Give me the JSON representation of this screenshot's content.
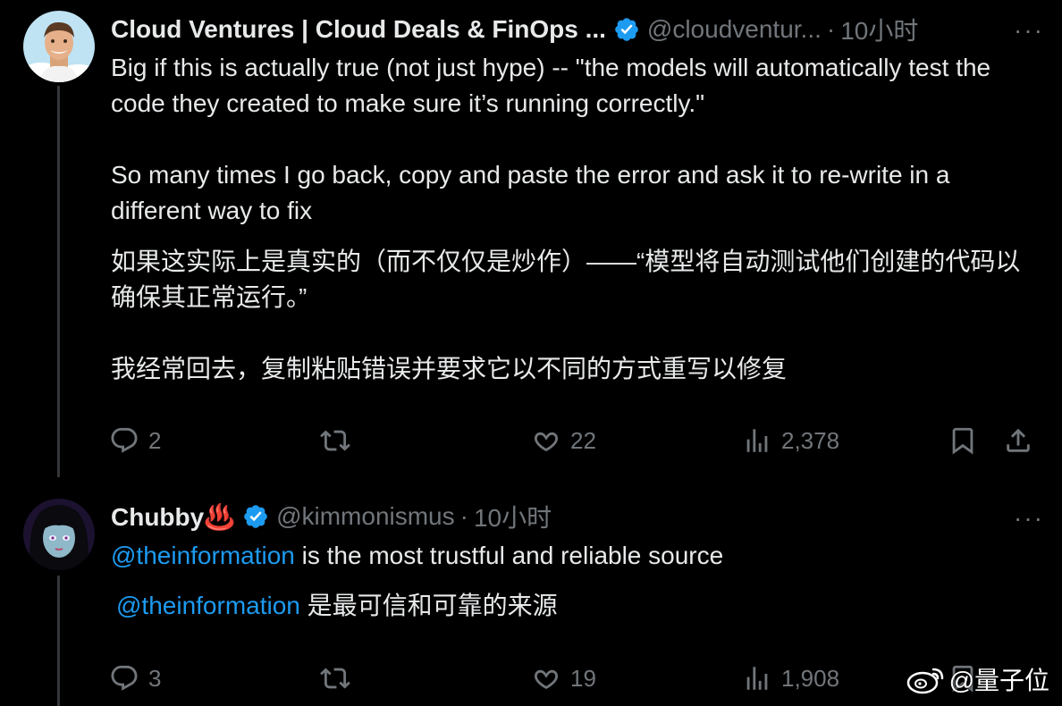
{
  "tweet1": {
    "author_name": "Cloud Ventures | Cloud Deals & FinOps ...",
    "handle": "@cloudventur...",
    "dot": "·",
    "time": "10小时",
    "more": "···",
    "text_en": "Big if this is actually true (not just hype) -- \"the models will automatically test the code they created to make sure it’s running correctly.\"\n\nSo many times I go back, copy and paste the error and ask it to re-write in a different way to fix",
    "text_zh": "如果这实际上是真实的（而不仅仅是炒作）——“模型将自动测试他们创建的代码以确保其正常运行。”\n\n我经常回去，复制粘贴错误并要求它以不同的方式重写以修复",
    "actions": {
      "replies": "2",
      "likes": "22",
      "views": "2,378"
    }
  },
  "tweet2": {
    "author_name": "Chubby♨️",
    "handle": "@kimmonismus",
    "dot": "·",
    "time": "10小时",
    "more": "···",
    "mention": "@theinformation",
    "text_en_rest": " is the most trustful and reliable source",
    "text_zh_rest": " 是最可信和可靠的来源",
    "actions": {
      "replies": "3",
      "likes": "19",
      "views": "1,908"
    }
  },
  "watermark": {
    "text": "@量子位",
    "icon": "weibo-icon"
  },
  "colors": {
    "background": "#000000",
    "text": "#e7e9ea",
    "muted": "#71767b",
    "accent": "#1d9bf0",
    "verified": "#1d9bf0",
    "thread_line": "#333639"
  }
}
